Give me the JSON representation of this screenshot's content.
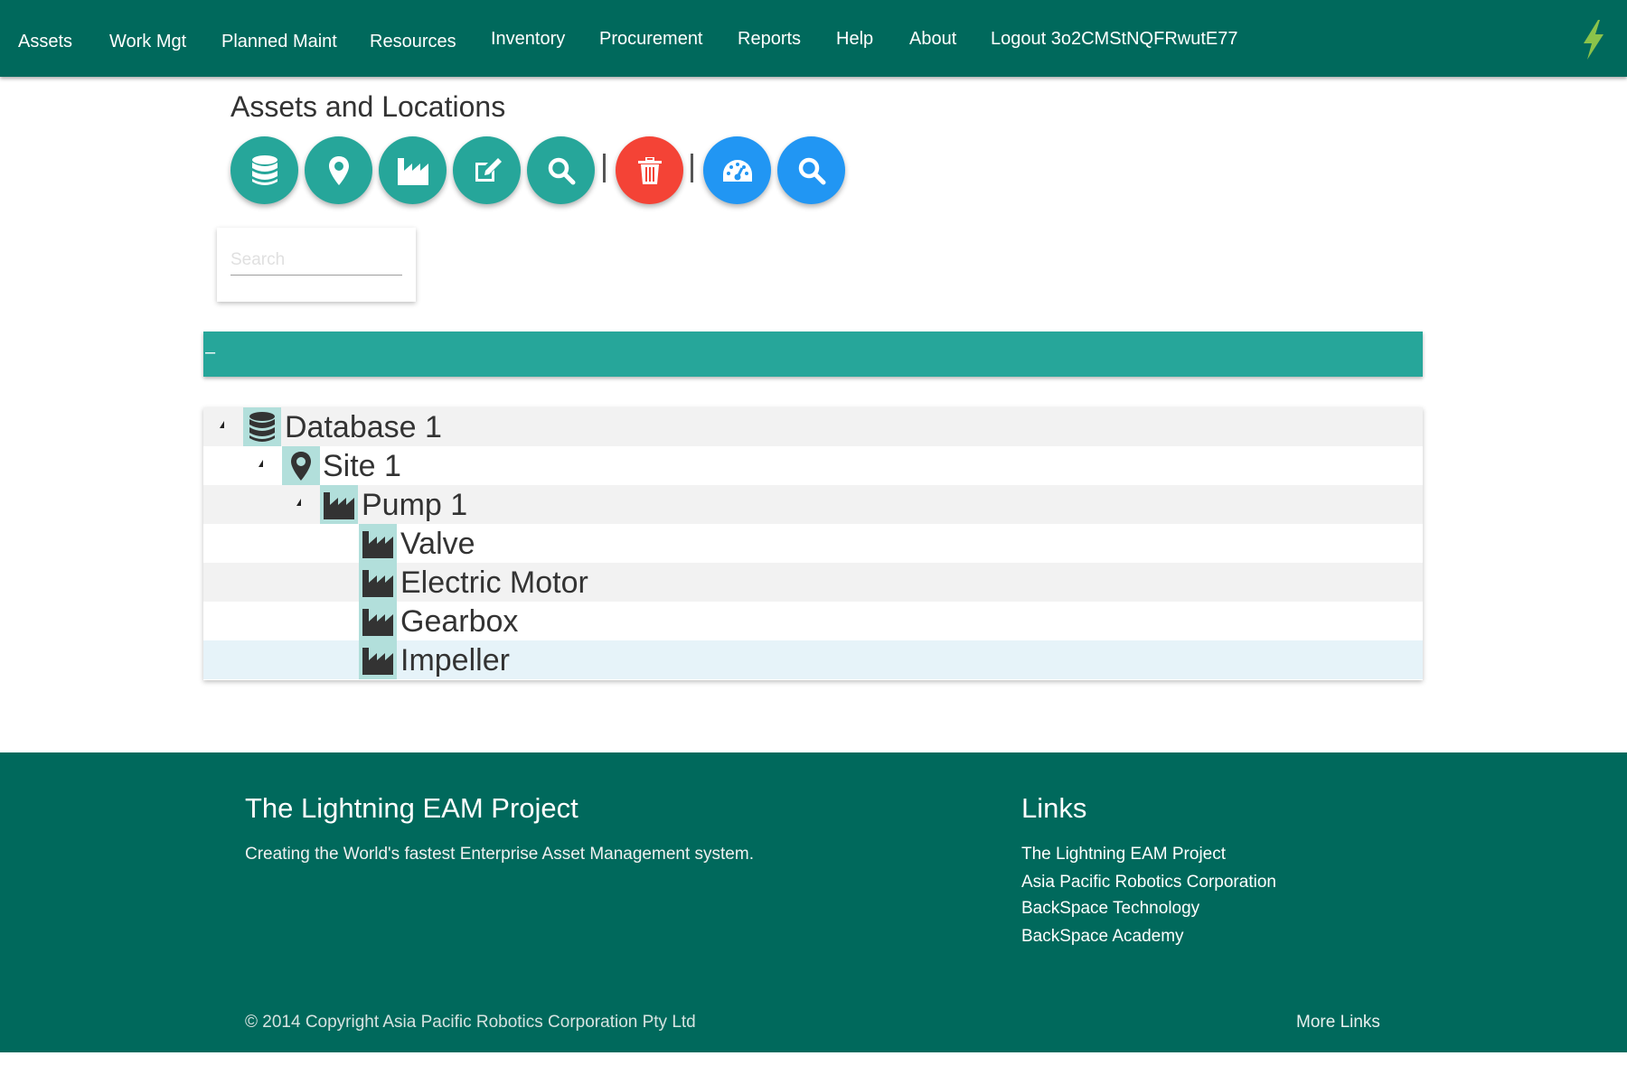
{
  "nav": {
    "items": [
      {
        "label": "Assets"
      },
      {
        "label": "Work Mgt"
      },
      {
        "label": "Planned Maint"
      },
      {
        "label": "Resources"
      },
      {
        "label": "Inventory"
      },
      {
        "label": "Procurement"
      },
      {
        "label": "Reports"
      },
      {
        "label": "Help"
      },
      {
        "label": "About"
      },
      {
        "label": "Logout 3o2CMStNQFRwutE77"
      }
    ],
    "logo_icon": "lightning-bolt-icon",
    "background": "#00695c",
    "logo_color": "#8bc34a"
  },
  "page": {
    "title": "Assets and Locations"
  },
  "toolbar": {
    "buttons": [
      {
        "icon": "database-icon",
        "color": "#26a69a"
      },
      {
        "icon": "map-marker-icon",
        "color": "#26a69a"
      },
      {
        "icon": "industry-icon",
        "color": "#26a69a"
      },
      {
        "icon": "edit-icon",
        "color": "#26a69a"
      },
      {
        "icon": "search-icon",
        "color": "#26a69a"
      },
      {
        "icon": "trash-icon",
        "color": "#f44336"
      },
      {
        "icon": "dashboard-icon",
        "color": "#2196f3"
      },
      {
        "icon": "search-icon",
        "color": "#2196f3"
      }
    ],
    "separator": "|"
  },
  "search": {
    "placeholder": "Search",
    "value": ""
  },
  "collapsible": {
    "label": "–",
    "color": "#26a69a"
  },
  "tree": {
    "nodes": [
      {
        "label": "Database 1",
        "icon": "database-icon",
        "level": 0,
        "expanded": true
      },
      {
        "label": "Site 1",
        "icon": "map-marker-icon",
        "level": 1,
        "expanded": true
      },
      {
        "label": "Pump 1",
        "icon": "industry-icon",
        "level": 2,
        "expanded": true
      },
      {
        "label": "Valve",
        "icon": "industry-icon",
        "level": 3
      },
      {
        "label": "Electric Motor",
        "icon": "industry-icon",
        "level": 3
      },
      {
        "label": "Gearbox",
        "icon": "industry-icon",
        "level": 3
      },
      {
        "label": "Impeller",
        "icon": "industry-icon",
        "level": 3,
        "selected": true
      }
    ]
  },
  "footer": {
    "title": "The Lightning EAM Project",
    "tagline": "Creating the World's fastest Enterprise Asset Management system.",
    "links_title": "Links",
    "links": [
      {
        "label": "The Lightning EAM Project"
      },
      {
        "label": "Asia Pacific Robotics Corporation"
      },
      {
        "label": "BackSpace Technology"
      },
      {
        "label": "BackSpace Academy"
      }
    ],
    "copyright": "© 2014 Copyright Asia Pacific Robotics Corporation Pty Ltd",
    "more_links": "More Links"
  }
}
